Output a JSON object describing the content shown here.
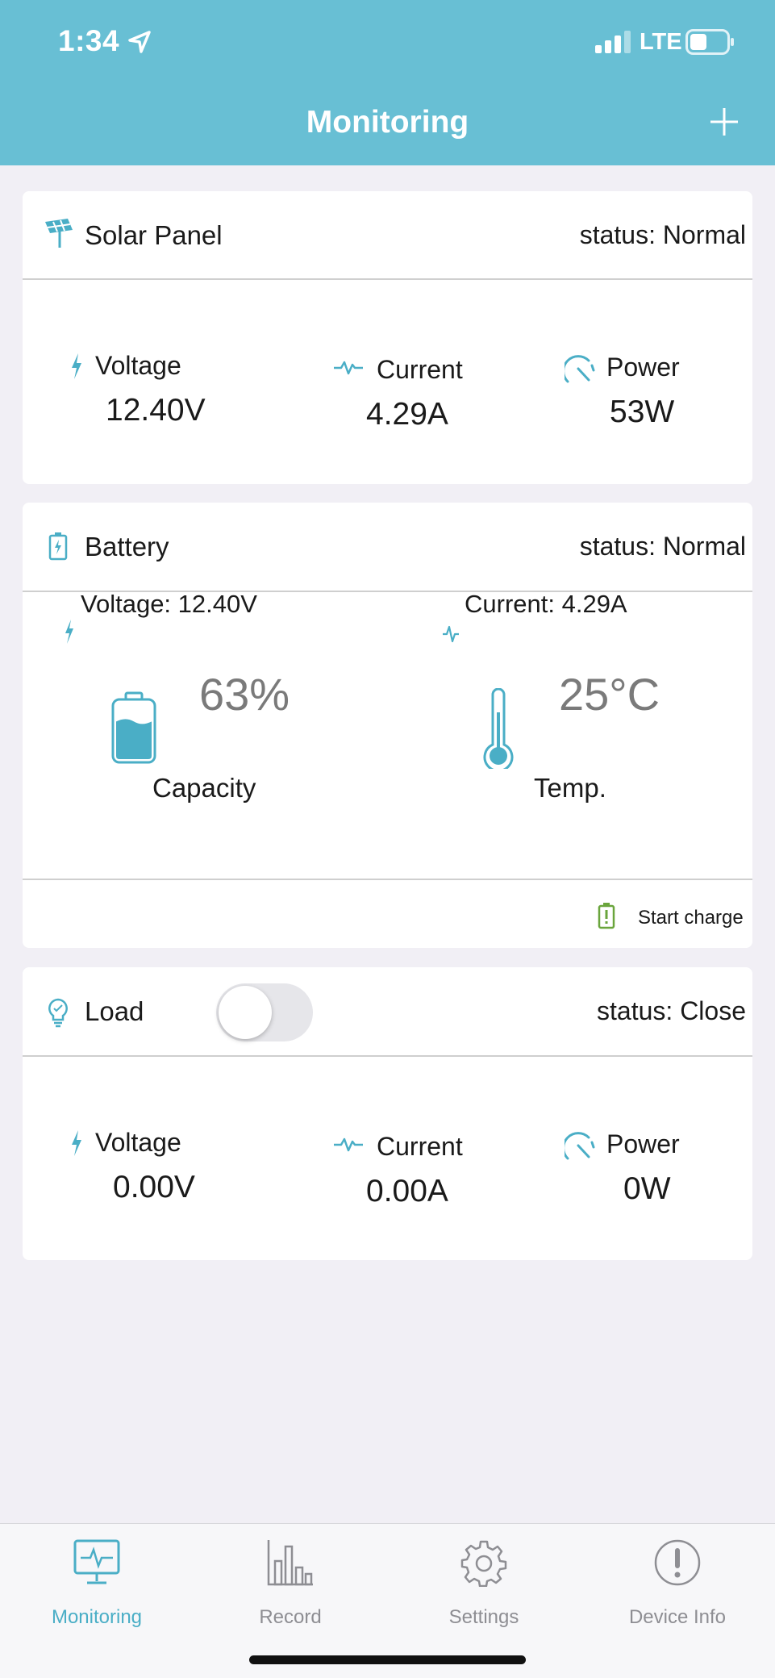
{
  "status_bar": {
    "time": "1:34",
    "network": "LTE"
  },
  "nav": {
    "title": "Monitoring"
  },
  "solar_panel": {
    "title": "Solar Panel",
    "status": "status: Normal",
    "voltage_label": "Voltage",
    "voltage_value": "12.40V",
    "current_label": "Current",
    "current_value": "4.29A",
    "power_label": "Power",
    "power_value": "53W"
  },
  "battery": {
    "title": "Battery",
    "status": "status: Normal",
    "voltage_text": "Voltage: 12.40V",
    "current_text": "Current: 4.29A",
    "capacity_value": "63%",
    "capacity_fraction": 0.63,
    "capacity_label": "Capacity",
    "temp_value": "25°C",
    "temp_label": "Temp.",
    "start_charge_label": "Start charge"
  },
  "load": {
    "title": "Load",
    "toggle_on": false,
    "status": "status: Close",
    "voltage_label": "Voltage",
    "voltage_value": "0.00V",
    "current_label": "Current",
    "current_value": "0.00A",
    "power_label": "Power",
    "power_value": "0W"
  },
  "tabs": [
    {
      "label": "Monitoring",
      "icon": "monitor-icon",
      "active": true
    },
    {
      "label": "Record",
      "icon": "bar-chart-icon",
      "active": false
    },
    {
      "label": "Settings",
      "icon": "gear-icon",
      "active": false
    },
    {
      "label": "Device Info",
      "icon": "info-icon",
      "active": false
    }
  ],
  "colors": {
    "accent": "#68bfd4",
    "tab_active": "#4aaec6",
    "charge_green": "#6aa53c",
    "background": "#f1eff5"
  }
}
